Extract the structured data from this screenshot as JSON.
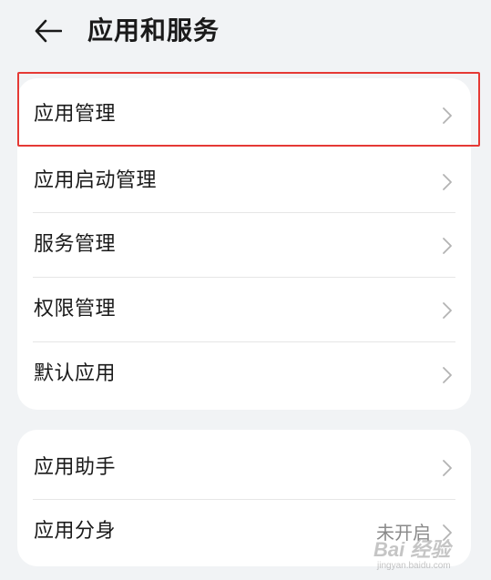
{
  "header": {
    "back_icon": "arrow-left-icon",
    "title": "应用和服务"
  },
  "settings_group_1": {
    "items": [
      {
        "label": "应用管理",
        "icon": "chevron-right-icon",
        "highlighted": true
      },
      {
        "label": "应用启动管理",
        "icon": "chevron-right-icon"
      },
      {
        "label": "服务管理",
        "icon": "chevron-right-icon"
      },
      {
        "label": "权限管理",
        "icon": "chevron-right-icon"
      },
      {
        "label": "默认应用",
        "icon": "chevron-right-icon"
      }
    ]
  },
  "settings_group_2": {
    "items": [
      {
        "label": "应用助手",
        "icon": "chevron-right-icon"
      },
      {
        "label": "应用分身",
        "value": "未开启",
        "icon": "chevron-right-icon"
      }
    ]
  },
  "watermark": {
    "main": "Bai 经验",
    "sub": "jingyan.baidu.com"
  },
  "colors": {
    "background": "#f1f3f5",
    "card": "#ffffff",
    "highlight": "#e53935",
    "secondary_text": "#8a8a8a"
  }
}
